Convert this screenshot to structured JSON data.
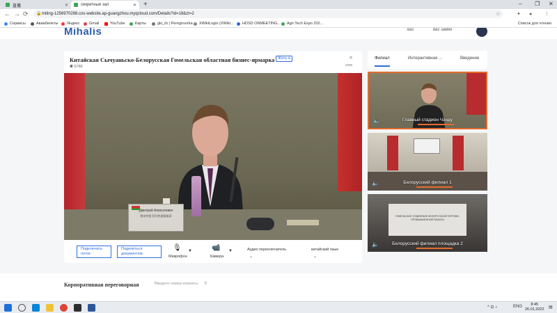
{
  "browser": {
    "tabs": [
      {
        "label": "直播",
        "color": "#3aa757"
      },
      {
        "label": "секретный зал",
        "color": "#3aa757"
      }
    ],
    "new_tab": "+",
    "address": "miting-1256970268.cos-website.ap-guangzhou.myqcloud.com/Details?id=18&zt=2",
    "bookmarks": [
      "Сервисы",
      "Авиабилеты",
      "Яндекс",
      "Gmail",
      "YouTube",
      "Карты",
      "gki_rb | Peregovorka",
      "XWikiLogin (XWiki...",
      "HDSD ONMEETING...",
      "Agri Tech Expo 202..."
    ],
    "bookmarks_right": "Список для чтения"
  },
  "site": {
    "logo": "Mihalis",
    "header_links": [
      "вас",
      "вас замки"
    ]
  },
  "event": {
    "title": "Китайская Сычуаньско-Белорусская Гомельская областная бизнес-ярмарка",
    "badge": "Жать в",
    "views": "6785",
    "share_label": "2008"
  },
  "video": {
    "nameplate_name": "Дмитрий Алексеевич",
    "nameplate_cn": "德米特里·阿列克谢耶维奇"
  },
  "controls": {
    "connect_stream": "Подключить поток",
    "share_docs": "Поделиться документом",
    "microphone": "Микрофон",
    "camera": "Камера",
    "audio_switch": "Аудио переключатель",
    "language": "китайский язык"
  },
  "side": {
    "tabs": [
      "Филиал",
      "Интерактивная ...",
      "Введение"
    ],
    "thumbs": [
      {
        "caption": "Главный стадион Чэнду"
      },
      {
        "caption": "Белорусский филиал 1"
      },
      {
        "caption": "Белорусский филиал площадка 2"
      }
    ],
    "thumb3_sign": "ГОМЕЛЬСКОЕ ОТДЕЛЕНИЕ БЕЛОРУССКОЙ ТОРГОВО-ПРОМЫШЛЕННОЙ ПАЛАТЫ"
  },
  "corporate": {
    "title": "Корпоративная переговорная",
    "placeholder": "Введите номер комнаты"
  },
  "taskbar": {
    "lang": "ENG",
    "time": "8:45",
    "date": "26.01.2022"
  }
}
